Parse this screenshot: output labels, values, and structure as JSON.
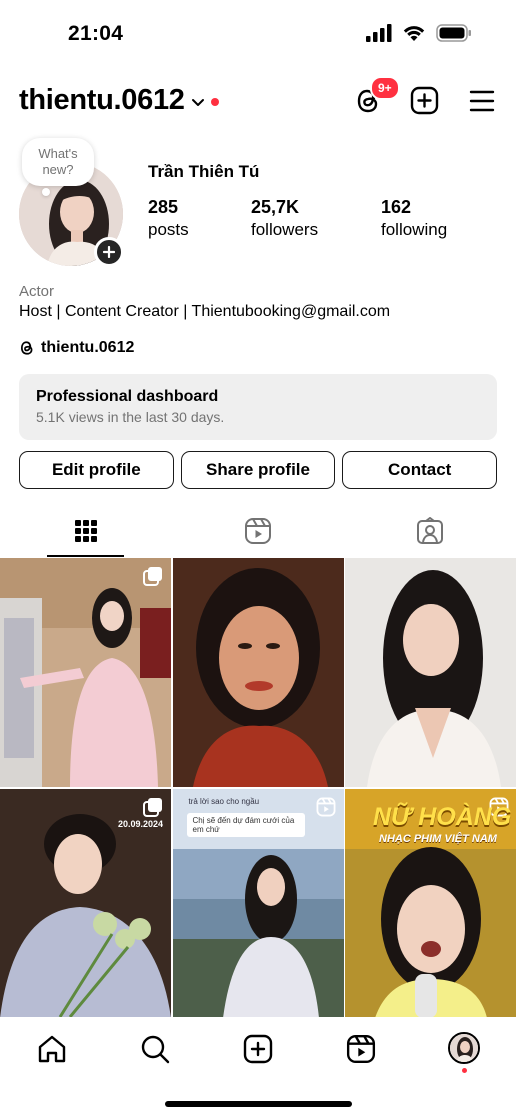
{
  "status_bar": {
    "time": "21:04"
  },
  "header": {
    "username": "thientu.0612",
    "threads_badge": "9+"
  },
  "note": {
    "placeholder": "What's new?"
  },
  "profile": {
    "full_name": "Trần Thiên Tú",
    "stats": [
      {
        "value": "285",
        "label": "posts"
      },
      {
        "value": "25,7K",
        "label": "followers"
      },
      {
        "value": "162",
        "label": "following"
      }
    ],
    "category": "Actor",
    "bio": "Host | Content Creator | Thientubooking@gmail.com",
    "threads_handle": "thientu.0612"
  },
  "dashboard": {
    "title": "Professional dashboard",
    "subtitle": "5.1K views in the last 30 days."
  },
  "buttons": {
    "edit": "Edit profile",
    "share": "Share profile",
    "contact": "Contact"
  },
  "grid": {
    "post4_date": "20.09.2024",
    "post5_caption1": "Chị sẽ đến dự đám cưới của em chứ",
    "post5_caption2": "trả lời sao cho ngầu",
    "post6_title1": "NỮ HOÀNG",
    "post6_title2": "NHẠC PHIM VIỆT NAM"
  },
  "colors": {
    "accent_red": "#ff3040",
    "dashboard_bg": "#efefef",
    "muted_text": "#737373"
  }
}
